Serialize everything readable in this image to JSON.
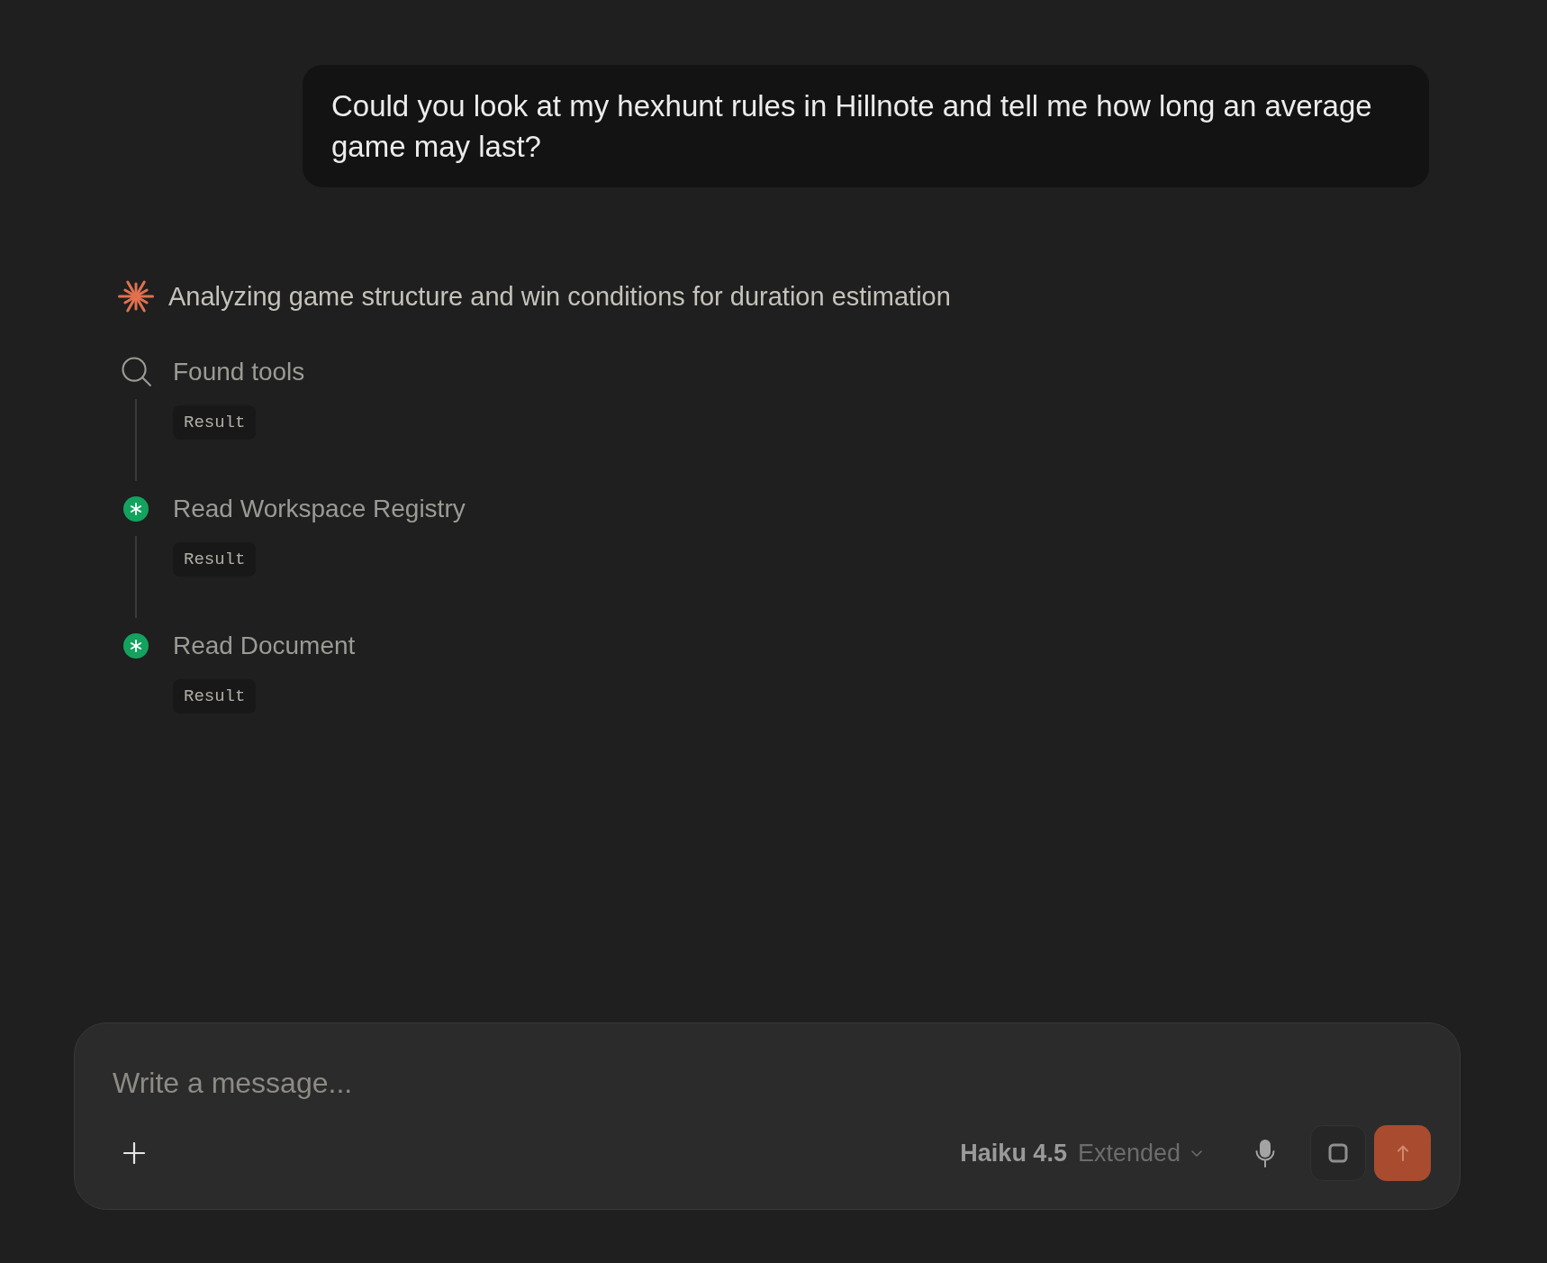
{
  "user_message": {
    "text": "Could you look at my hexhunt rules in Hillnote and tell me how long an average game may last?"
  },
  "status": {
    "text": "Analyzing game structure and win conditions for duration estimation"
  },
  "steps": [
    {
      "kind": "search",
      "title": "Found tools",
      "result": "Result"
    },
    {
      "kind": "tool",
      "title": "Read Workspace Registry",
      "result": "Result"
    },
    {
      "kind": "tool",
      "title": "Read Document",
      "result": "Result"
    }
  ],
  "composer": {
    "placeholder": "Write a message...",
    "model": "Haiku 4.5",
    "mode": "Extended"
  }
}
